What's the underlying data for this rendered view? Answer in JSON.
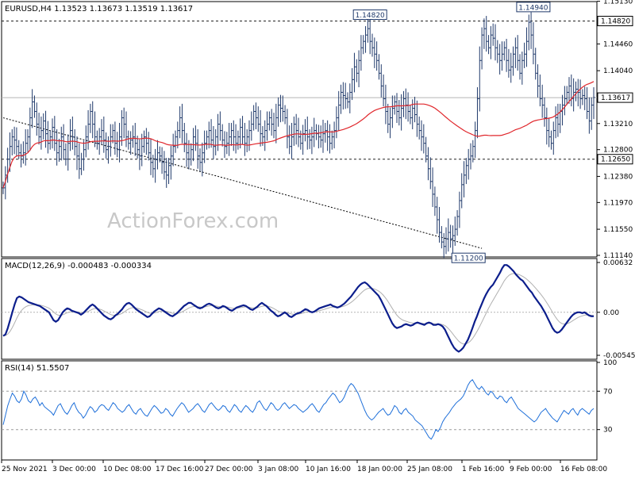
{
  "chart_data": {
    "type": "line",
    "title": "EURUSD,H4  1.13523 1.13673 1.13519 1.13617",
    "watermark": "ActionForex.com",
    "x_ticks": [
      "25 Nov 2021",
      "3 Dec 00:00",
      "10 Dec 08:00",
      "17 Dec 16:00",
      "27 Dec 00:00",
      "3 Jan 08:00",
      "10 Jan 16:00",
      "18 Jan 00:00",
      "25 Jan 08:00",
      "1 Feb 16:00",
      "9 Feb 00:00",
      "16 Feb 08:00"
    ],
    "price": {
      "ylim": [
        1.1114,
        1.151
      ],
      "yticks": [
        "1.15130",
        "1.14460",
        "1.14040",
        "1.13210",
        "1.12800",
        "1.12380",
        "1.11970",
        "1.11550",
        "1.11140"
      ],
      "ytick_values": [
        1.1513,
        1.1446,
        1.1404,
        1.1321,
        1.128,
        1.1238,
        1.1197,
        1.1155,
        1.1114
      ],
      "hlines": [
        {
          "value": 1.1482,
          "label": "1.14820",
          "style": "dashed"
        },
        {
          "value": 1.13617,
          "label": "1.13617",
          "style": "solid"
        },
        {
          "value": 1.1265,
          "label": "1.12650",
          "style": "dashed"
        }
      ],
      "annotations": [
        {
          "label": "1.14820",
          "value": 1.1482,
          "bar": 164
        },
        {
          "label": "1.14940",
          "value": 1.1494,
          "bar": 237
        },
        {
          "label": "1.11200",
          "value": 1.112,
          "bar": 208
        }
      ],
      "trendline": [
        {
          "bar": 0,
          "value": 1.133
        },
        {
          "bar": 214,
          "value": 1.1125
        }
      ],
      "close": [
        1.122,
        1.124,
        1.1265,
        1.1285,
        1.13,
        1.1295,
        1.1285,
        1.1275,
        1.127,
        1.1275,
        1.129,
        1.13,
        1.133,
        1.1355,
        1.134,
        1.132,
        1.13,
        1.131,
        1.1325,
        1.1305,
        1.129,
        1.13,
        1.1315,
        1.129,
        1.1275,
        1.1285,
        1.13,
        1.128,
        1.1265,
        1.129,
        1.131,
        1.13,
        1.1285,
        1.127,
        1.125,
        1.1265,
        1.128,
        1.13,
        1.132,
        1.134,
        1.132,
        1.13,
        1.129,
        1.13,
        1.131,
        1.1295,
        1.128,
        1.1285,
        1.13,
        1.131,
        1.129,
        1.128,
        1.13,
        1.133,
        1.132,
        1.13,
        1.129,
        1.1295,
        1.13,
        1.129,
        1.128,
        1.127,
        1.1285,
        1.13,
        1.129,
        1.1275,
        1.126,
        1.125,
        1.1265,
        1.1275,
        1.127,
        1.126,
        1.1245,
        1.124,
        1.1255,
        1.127,
        1.1285,
        1.13,
        1.131,
        1.133,
        1.131,
        1.129,
        1.1275,
        1.1265,
        1.128,
        1.13,
        1.129,
        1.127,
        1.126,
        1.1275,
        1.129,
        1.13,
        1.131,
        1.1295,
        1.1285,
        1.13,
        1.132,
        1.131,
        1.1295,
        1.1285,
        1.129,
        1.13,
        1.131,
        1.13,
        1.129,
        1.13,
        1.1315,
        1.13,
        1.129,
        1.13,
        1.131,
        1.132,
        1.134,
        1.133,
        1.132,
        1.1305,
        1.13,
        1.131,
        1.132,
        1.133,
        1.132,
        1.131,
        1.133,
        1.135,
        1.1345,
        1.134,
        1.133,
        1.13,
        1.1285,
        1.13,
        1.132,
        1.131,
        1.13,
        1.129,
        1.1305,
        1.131,
        1.13,
        1.1295,
        1.13,
        1.131,
        1.1305,
        1.13,
        1.1295,
        1.1305,
        1.131,
        1.13,
        1.129,
        1.13,
        1.131,
        1.133,
        1.135,
        1.137,
        1.1365,
        1.136,
        1.1355,
        1.137,
        1.139,
        1.141,
        1.14,
        1.142,
        1.144,
        1.145,
        1.146,
        1.147,
        1.145,
        1.144,
        1.143,
        1.142,
        1.14,
        1.138,
        1.136,
        1.134,
        1.132,
        1.133,
        1.1345,
        1.1355,
        1.134,
        1.133,
        1.1345,
        1.136,
        1.135,
        1.134,
        1.133,
        1.1345,
        1.1335,
        1.132,
        1.131,
        1.13,
        1.129,
        1.127,
        1.125,
        1.123,
        1.121,
        1.119,
        1.117,
        1.115,
        1.1135,
        1.1128,
        1.114,
        1.115,
        1.114,
        1.1145,
        1.1155,
        1.1175,
        1.12,
        1.1225,
        1.124,
        1.1255,
        1.1265,
        1.127,
        1.1285,
        1.131,
        1.136,
        1.142,
        1.146,
        1.147,
        1.145,
        1.144,
        1.146,
        1.1455,
        1.144,
        1.143,
        1.142,
        1.143,
        1.144,
        1.142,
        1.1405,
        1.141,
        1.143,
        1.144,
        1.142,
        1.14,
        1.142,
        1.143,
        1.145,
        1.148,
        1.146,
        1.143,
        1.14,
        1.138,
        1.136,
        1.135,
        1.133,
        1.131,
        1.13,
        1.129,
        1.131,
        1.133,
        1.132,
        1.134,
        1.135,
        1.136,
        1.137,
        1.138,
        1.136,
        1.137,
        1.1375,
        1.137,
        1.136,
        1.1365,
        1.136,
        1.134,
        1.1325,
        1.135,
        1.1362
      ],
      "ma_color": "#e0262b",
      "bar_color": "#203a6b"
    },
    "macd": {
      "label": "MACD(12,26,9) -0.000483 -0.000334",
      "ylim": [
        -0.005455,
        0.00632
      ],
      "yticks": [
        "0.00632",
        "0.00",
        "-0.005455"
      ],
      "ytick_values": [
        0.00632,
        0,
        -0.005455
      ],
      "line_color": "#0c1e8c",
      "signal_color": "#b0b0b0",
      "values": [
        -0.003,
        -0.0028,
        -0.002,
        -0.001,
        0.0,
        0.001,
        0.0018,
        0.002,
        0.0019,
        0.0017,
        0.0015,
        0.0013,
        0.0012,
        0.0011,
        0.001,
        0.0009,
        0.0008,
        0.0006,
        0.0004,
        0.0002,
        0.0,
        -0.0005,
        -0.001,
        -0.0012,
        -0.001,
        -0.0005,
        0.0,
        0.0003,
        0.0005,
        0.0004,
        0.0002,
        0.0001,
        0.0,
        -0.0001,
        -0.0003,
        -0.0001,
        0.0002,
        0.0005,
        0.0008,
        0.001,
        0.0008,
        0.0005,
        0.0002,
        -0.0001,
        -0.0004,
        -0.0006,
        -0.0008,
        -0.0009,
        -0.0007,
        -0.0004,
        -0.0002,
        0.0001,
        0.0004,
        0.0008,
        0.0011,
        0.0012,
        0.001,
        0.0007,
        0.0004,
        0.0002,
        0.0,
        -0.0002,
        -0.0004,
        -0.0006,
        -0.0005,
        -0.0002,
        0.0001,
        0.0003,
        0.0005,
        0.0004,
        0.0002,
        0.0,
        -0.0002,
        -0.0004,
        -0.0005,
        -0.0003,
        -0.0001,
        0.0002,
        0.0005,
        0.0008,
        0.001,
        0.0012,
        0.0012,
        0.001,
        0.0008,
        0.0006,
        0.0005,
        0.0006,
        0.0008,
        0.001,
        0.0011,
        0.001,
        0.0008,
        0.0006,
        0.0005,
        0.0006,
        0.0008,
        0.0007,
        0.0005,
        0.0003,
        0.0002,
        0.0004,
        0.0006,
        0.0007,
        0.0008,
        0.0009,
        0.0008,
        0.0006,
        0.0004,
        0.0003,
        0.0005,
        0.0007,
        0.001,
        0.0012,
        0.001,
        0.0008,
        0.0005,
        0.0002,
        0.0,
        -0.0003,
        -0.0005,
        -0.0004,
        -0.0002,
        0.0,
        -0.0002,
        -0.0005,
        -0.0006,
        -0.0004,
        -0.0002,
        -0.0001,
        0.0,
        0.0002,
        0.0004,
        0.0003,
        0.0001,
        0.0,
        0.0001,
        0.0003,
        0.0005,
        0.0006,
        0.0007,
        0.0008,
        0.0009,
        0.001,
        0.0008,
        0.0007,
        0.0006,
        0.0007,
        0.0009,
        0.0011,
        0.0014,
        0.0017,
        0.002,
        0.0024,
        0.0028,
        0.0032,
        0.0035,
        0.0037,
        0.0038,
        0.0036,
        0.0033,
        0.003,
        0.0027,
        0.0024,
        0.0021,
        0.0016,
        0.001,
        0.0004,
        -0.0002,
        -0.0008,
        -0.0014,
        -0.0018,
        -0.002,
        -0.0019,
        -0.0018,
        -0.0016,
        -0.0015,
        -0.0016,
        -0.0017,
        -0.0016,
        -0.0014,
        -0.0013,
        -0.0014,
        -0.0015,
        -0.0016,
        -0.0014,
        -0.0013,
        -0.0014,
        -0.0016,
        -0.0016,
        -0.0015,
        -0.0016,
        -0.0018,
        -0.0022,
        -0.0028,
        -0.0034,
        -0.004,
        -0.0045,
        -0.0048,
        -0.005,
        -0.0048,
        -0.0045,
        -0.004,
        -0.0035,
        -0.0028,
        -0.002,
        -0.0012,
        -0.0005,
        0.0003,
        0.001,
        0.0017,
        0.0023,
        0.0028,
        0.0032,
        0.0035,
        0.004,
        0.0045,
        0.005,
        0.0056,
        0.006,
        0.006,
        0.0058,
        0.0055,
        0.0052,
        0.0048,
        0.0045,
        0.0042,
        0.004,
        0.0036,
        0.0032,
        0.0028,
        0.0025,
        0.002,
        0.0016,
        0.0012,
        0.0008,
        0.0003,
        -0.0002,
        -0.0008,
        -0.0014,
        -0.002,
        -0.0024,
        -0.0026,
        -0.0025,
        -0.0022,
        -0.0018,
        -0.0014,
        -0.001,
        -0.0006,
        -0.0003,
        -0.0001,
        0.0,
        0.0,
        -0.0001,
        0.0,
        -0.0002,
        -0.0004,
        -0.0005,
        -0.0005
      ]
    },
    "rsi": {
      "label": "RSI(14) 51.5507",
      "ylim": [
        0,
        100
      ],
      "yticks": [
        "100",
        "70",
        "30",
        "0"
      ],
      "ytick_values": [
        100,
        70,
        30,
        0
      ],
      "levels": [
        70,
        30
      ],
      "line_color": "#1e6fd9",
      "values": [
        35,
        45,
        55,
        62,
        68,
        65,
        60,
        58,
        62,
        70,
        66,
        60,
        58,
        62,
        64,
        60,
        55,
        58,
        54,
        52,
        50,
        48,
        45,
        50,
        55,
        57,
        52,
        48,
        46,
        50,
        55,
        58,
        52,
        48,
        46,
        42,
        45,
        50,
        54,
        52,
        48,
        50,
        54,
        56,
        55,
        52,
        50,
        54,
        58,
        56,
        52,
        50,
        48,
        50,
        54,
        56,
        52,
        48,
        46,
        50,
        52,
        48,
        45,
        44,
        48,
        52,
        55,
        53,
        50,
        47,
        48,
        52,
        50,
        46,
        44,
        48,
        52,
        55,
        58,
        56,
        52,
        48,
        50,
        52,
        55,
        57,
        54,
        50,
        48,
        52,
        56,
        58,
        55,
        52,
        50,
        52,
        55,
        54,
        50,
        48,
        52,
        56,
        54,
        50,
        48,
        52,
        55,
        53,
        50,
        48,
        52,
        58,
        60,
        56,
        52,
        50,
        54,
        58,
        56,
        52,
        50,
        52,
        56,
        58,
        55,
        52,
        54,
        56,
        55,
        52,
        50,
        48,
        50,
        52,
        55,
        57,
        54,
        50,
        48,
        52,
        56,
        58,
        62,
        65,
        68,
        66,
        62,
        58,
        60,
        64,
        70,
        75,
        78,
        76,
        72,
        68,
        62,
        56,
        50,
        45,
        42,
        40,
        42,
        45,
        48,
        50,
        52,
        48,
        45,
        46,
        50,
        55,
        53,
        48,
        46,
        50,
        52,
        48,
        46,
        44,
        40,
        38,
        36,
        34,
        30,
        26,
        22,
        20,
        24,
        30,
        28,
        32,
        38,
        42,
        45,
        48,
        52,
        55,
        58,
        60,
        62,
        65,
        70,
        76,
        80,
        82,
        78,
        74,
        72,
        75,
        72,
        68,
        66,
        70,
        68,
        64,
        62,
        65,
        64,
        60,
        58,
        62,
        64,
        60,
        56,
        52,
        50,
        48,
        46,
        44,
        42,
        40,
        38,
        40,
        44,
        48,
        50,
        52,
        48,
        45,
        42,
        40,
        38,
        42,
        46,
        50,
        48,
        46,
        50,
        52,
        48,
        45,
        50,
        52,
        50,
        48,
        46,
        50,
        52
      ]
    },
    "ma_period": 55
  }
}
